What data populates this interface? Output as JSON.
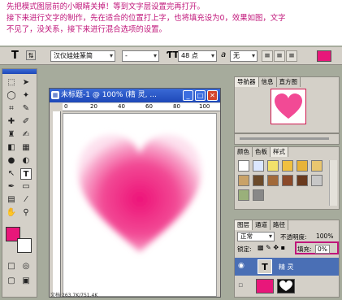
{
  "caption": {
    "line1": "先把模式图层前的小眼睛关掉！等到文字层设置完再打开。",
    "line2": "接下来进行文字的制作，先在适合的位置打上字，也将填充设为0，效果如图，文字",
    "line3": "不见了，没关系，接下来进行混合选项的设置。"
  },
  "options_bar": {
    "tool_glyph": "T",
    "font_family": "汉仪娃娃篆简",
    "font_style": "-",
    "font_size": "48 点",
    "aa_label": "a",
    "aa_value": "无",
    "color_hex": "#e8177a"
  },
  "document": {
    "title": "未标题-1 @ 100% (精  灵, ...",
    "ruler_marks": [
      "0",
      "20",
      "40",
      "60",
      "80",
      "100"
    ],
    "heart_color": "#f0197d",
    "status_text": "文档:263.7K/751.4K"
  },
  "navigator": {
    "tabs": [
      "导航器",
      "信息",
      "直方图"
    ]
  },
  "styles_panel": {
    "tabs": [
      "颜色",
      "色板",
      "样式"
    ]
  },
  "layers_panel": {
    "tabs": [
      "图层",
      "通道",
      "路径"
    ],
    "blend_mode": "正常",
    "opacity_label": "不透明度:",
    "opacity_value": "100%",
    "lock_label": "锁定:",
    "fill_label": "填充:",
    "fill_value": "0%",
    "layers": [
      {
        "name": "精  灵"
      },
      {
        "name": ""
      }
    ]
  },
  "toolbox": {
    "foreground_color": "#e8177a",
    "background_color": "#ffffff"
  }
}
